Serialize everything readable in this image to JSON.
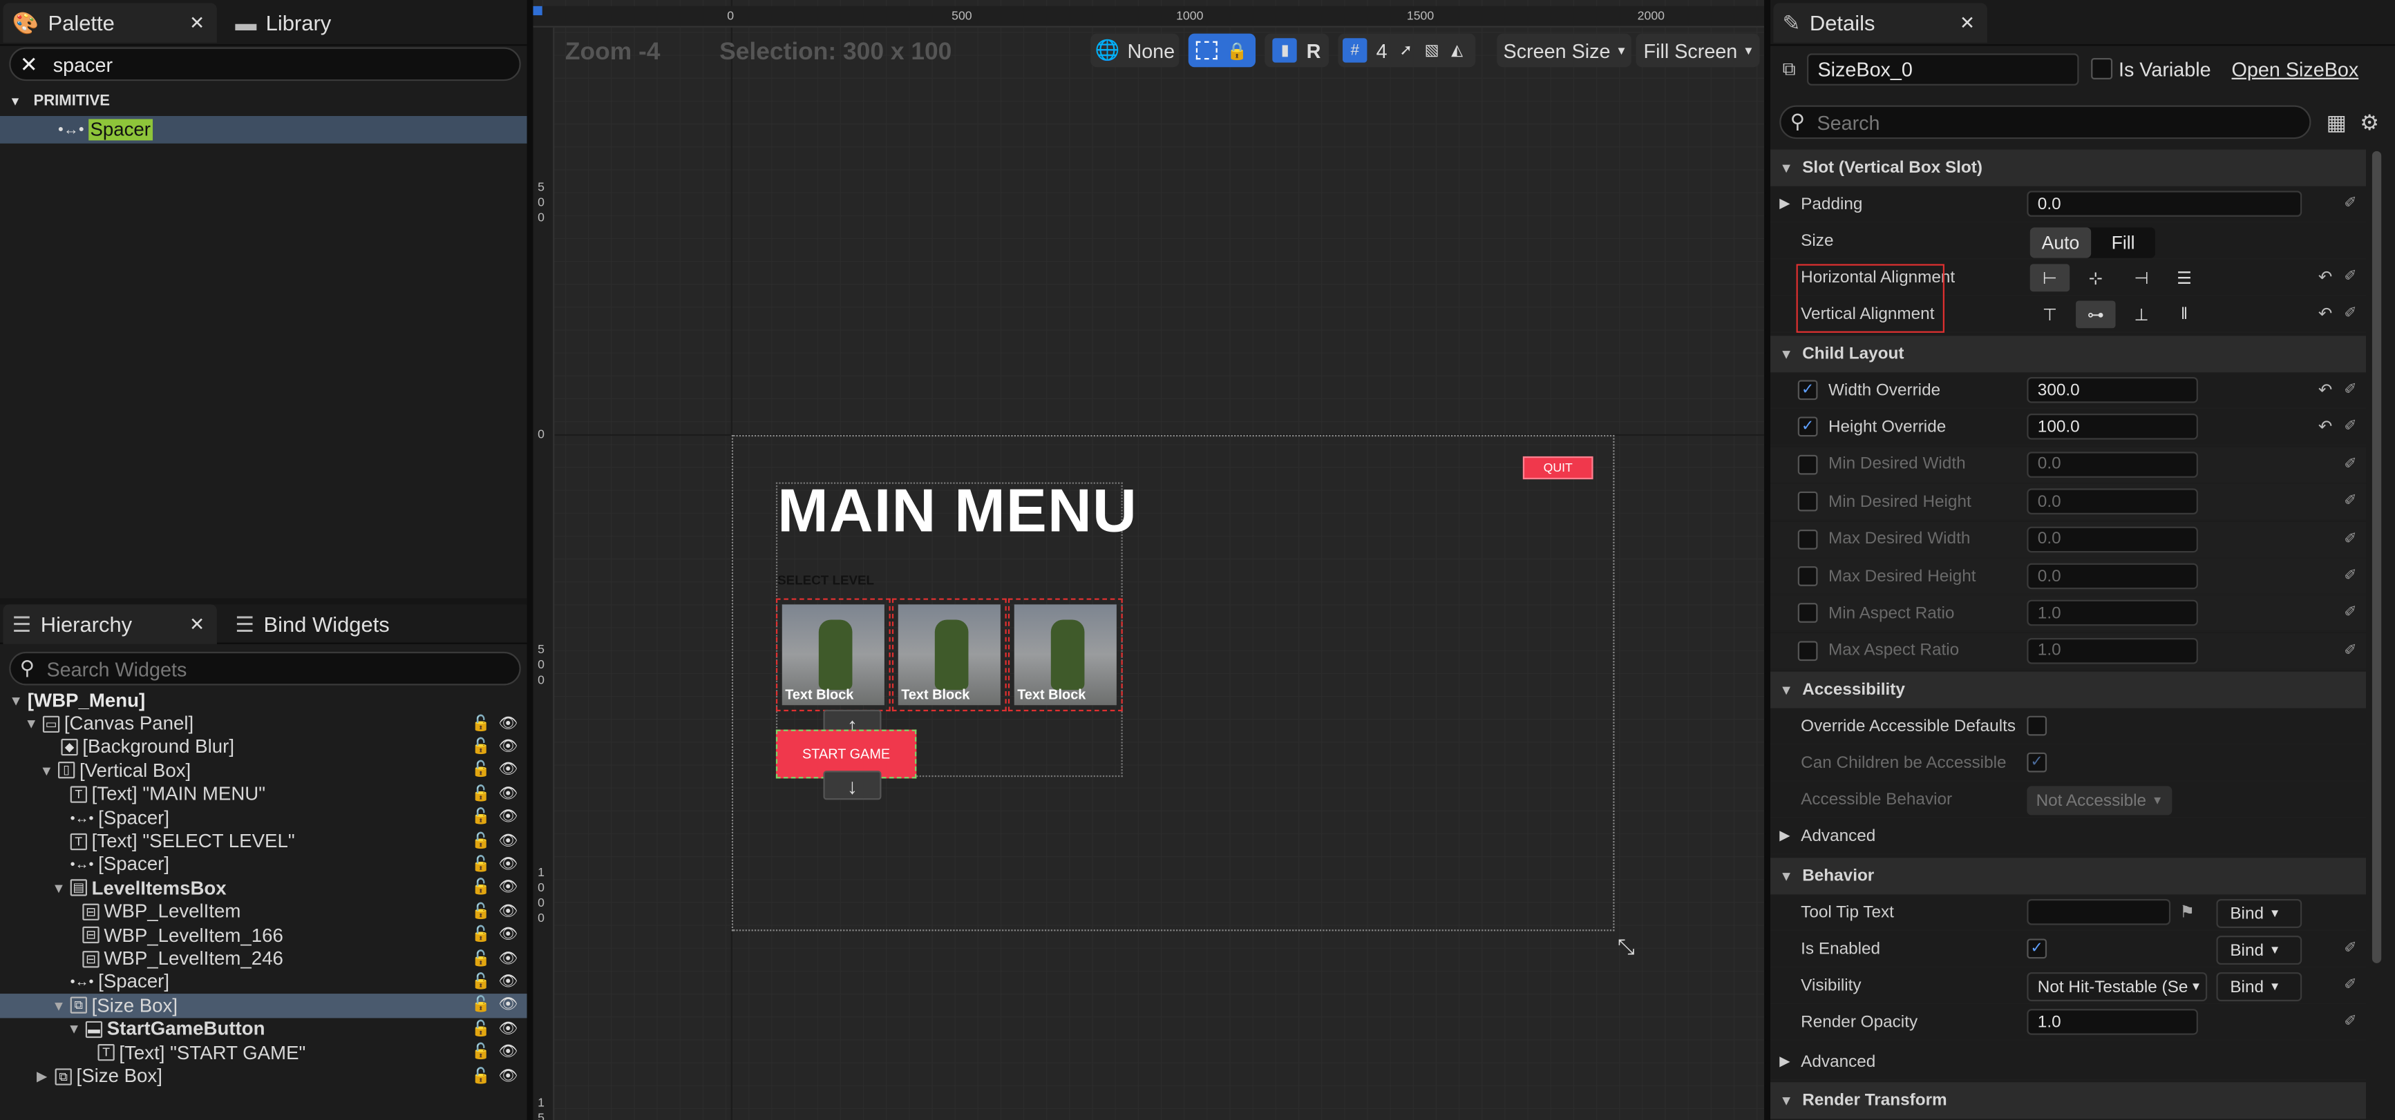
{
  "palette": {
    "tab_label": "Palette",
    "library_label": "Library",
    "search_value": "spacer",
    "category": "PRIMITIVE",
    "items": [
      {
        "label": "Spacer",
        "icon": "spacer-icon"
      }
    ]
  },
  "hierarchy": {
    "tab_label": "Hierarchy",
    "bind_widgets_label": "Bind Widgets",
    "search_placeholder": "Search Widgets",
    "rows": [
      {
        "label": "[WBP_Menu]"
      },
      {
        "label": "[Canvas Panel]"
      },
      {
        "label": "[Background Blur]"
      },
      {
        "label": "[Vertical Box]"
      },
      {
        "label": "[Text] \"MAIN MENU\""
      },
      {
        "label": "[Spacer]"
      },
      {
        "label": "[Text] \"SELECT LEVEL\""
      },
      {
        "label": "[Spacer]"
      },
      {
        "label": "LevelItemsBox"
      },
      {
        "label": "WBP_LevelItem"
      },
      {
        "label": "WBP_LevelItem_166"
      },
      {
        "label": "WBP_LevelItem_246"
      },
      {
        "label": "[Spacer]"
      },
      {
        "label": "[Size Box]"
      },
      {
        "label": "StartGameButton"
      },
      {
        "label": "[Text] \"START GAME\""
      },
      {
        "label": "[Size Box]"
      }
    ]
  },
  "viewport": {
    "zoom": "Zoom -4",
    "selection": "Selection: 300 x 100",
    "ruler_top": [
      "0",
      "500",
      "1000",
      "1500",
      "2000"
    ],
    "ruler_left": [
      "5\n0\n0",
      "0",
      "5\n0\n0",
      "1\n0\n0\n0",
      "1\n5"
    ],
    "toolbar": {
      "localization": "None",
      "r_label": "R",
      "grid_value": "4",
      "screen_size": "Screen Size",
      "fill_screen": "Fill Screen"
    },
    "preview": {
      "title": "MAIN MENU",
      "select_level": "SELECT LEVEL",
      "level_items": [
        "Text Block",
        "Text Block",
        "Text Block"
      ],
      "start_game": "START GAME",
      "quit": "QUIT",
      "up_arrow": "↑",
      "down_arrow": "↓"
    }
  },
  "details": {
    "tab_label": "Details",
    "widget_name": "SizeBox_0",
    "is_variable_label": "Is Variable",
    "open_label": "Open SizeBox",
    "search_placeholder": "Search",
    "slot_category": "Slot (Vertical Box Slot)",
    "padding_label": "Padding",
    "padding_value": "0.0",
    "size_label": "Size",
    "size_auto": "Auto",
    "size_fill": "Fill",
    "halign_label": "Horizontal Alignment",
    "valign_label": "Vertical Alignment",
    "child_layout_category": "Child Layout",
    "child_layout": [
      {
        "label": "Width Override",
        "value": "300.0",
        "checked": true
      },
      {
        "label": "Height Override",
        "value": "100.0",
        "checked": true
      },
      {
        "label": "Min Desired Width",
        "value": "0.0",
        "checked": false
      },
      {
        "label": "Min Desired Height",
        "value": "0.0",
        "checked": false
      },
      {
        "label": "Max Desired Width",
        "value": "0.0",
        "checked": false
      },
      {
        "label": "Max Desired Height",
        "value": "0.0",
        "checked": false
      },
      {
        "label": "Min Aspect Ratio",
        "value": "1.0",
        "checked": false
      },
      {
        "label": "Max Aspect Ratio",
        "value": "1.0",
        "checked": false
      }
    ],
    "accessibility_category": "Accessibility",
    "override_accessible_label": "Override Accessible Defaults",
    "can_children_label": "Can Children be Accessible",
    "accessible_behavior_label": "Accessible Behavior",
    "accessible_behavior_value": "Not Accessible",
    "advanced_label": "Advanced",
    "behavior_category": "Behavior",
    "tooltip_label": "Tool Tip Text",
    "is_enabled_label": "Is Enabled",
    "visibility_label": "Visibility",
    "visibility_value": "Not Hit-Testable (Se",
    "render_opacity_label": "Render Opacity",
    "render_opacity_value": "1.0",
    "bind_label": "Bind",
    "advanced2_label": "Advanced",
    "render_transform_category": "Render Transform"
  },
  "colors": {
    "accent": "#2f6fd6",
    "highlight": "#e03030",
    "button_red": "#f0384c"
  }
}
